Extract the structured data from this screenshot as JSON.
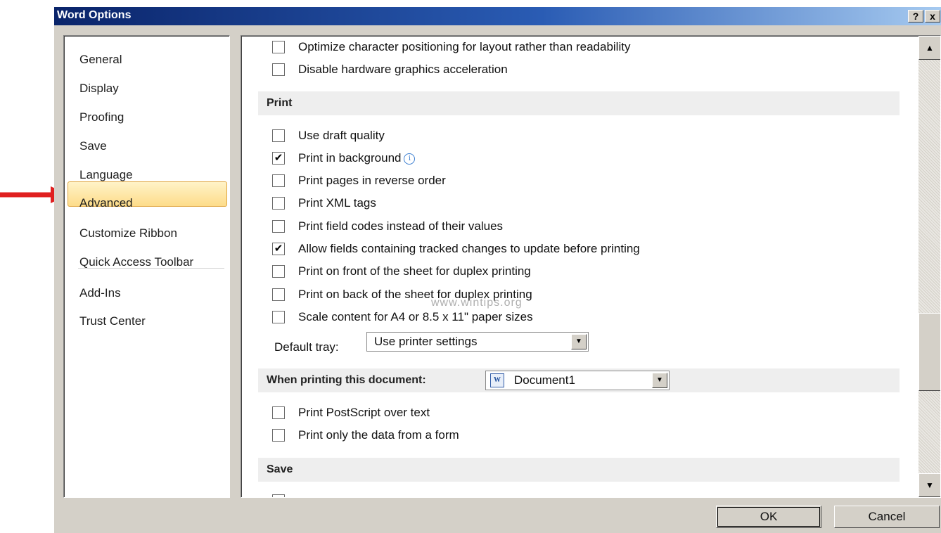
{
  "window": {
    "title": "Word Options",
    "help_button": "?",
    "close_button": "x"
  },
  "sidebar": {
    "items": [
      {
        "label": "General"
      },
      {
        "label": "Display"
      },
      {
        "label": "Proofing"
      },
      {
        "label": "Save"
      },
      {
        "label": "Language"
      },
      {
        "label": "Advanced",
        "selected": true
      },
      {
        "label": "Customize Ribbon"
      },
      {
        "label": "Quick Access Toolbar"
      },
      {
        "label": "Add-Ins"
      },
      {
        "label": "Trust Center"
      }
    ]
  },
  "content": {
    "display_options": [
      {
        "label": "Optimize character positioning for layout rather than readability",
        "checked": false
      },
      {
        "label": "Disable hardware graphics acceleration",
        "checked": false
      }
    ],
    "print_section": {
      "title": "Print",
      "options": [
        {
          "label": "Use draft quality",
          "checked": false
        },
        {
          "label": "Print in background",
          "checked": true,
          "info_icon": true
        },
        {
          "label": "Print pages in reverse order",
          "checked": false
        },
        {
          "label": "Print XML tags",
          "checked": false
        },
        {
          "label": "Print field codes instead of their values",
          "checked": false
        },
        {
          "label": "Allow fields containing tracked changes to update before printing",
          "checked": true
        },
        {
          "label": "Print on front of the sheet for duplex printing",
          "checked": false
        },
        {
          "label": "Print on back of the sheet for duplex printing",
          "checked": false
        },
        {
          "label": "Scale content for A4 or 8.5 x 11\" paper sizes",
          "checked": false
        }
      ],
      "default_tray_label": "Default tray:",
      "default_tray_value": "Use printer settings"
    },
    "when_printing_section": {
      "title": "When printing this document:",
      "document_value": "Document1",
      "options": [
        {
          "label": "Print PostScript over text",
          "checked": false
        },
        {
          "label": "Print only the data from a form",
          "checked": false
        }
      ]
    },
    "save_section": {
      "title": "Save"
    },
    "watermark": "www.wintips.org"
  },
  "buttons": {
    "ok": "OK",
    "cancel": "Cancel"
  },
  "icons": {
    "checkmark": "✔",
    "scroll_up": "▲",
    "scroll_down": "▼",
    "dropdown": "▼",
    "info": "i",
    "word_doc": "W"
  },
  "colors": {
    "title_bar": "#0a246a",
    "selected_item_border": "#e0a640",
    "selected_item_fill": "#fddc8a",
    "annotation_arrow": "#e02020"
  }
}
